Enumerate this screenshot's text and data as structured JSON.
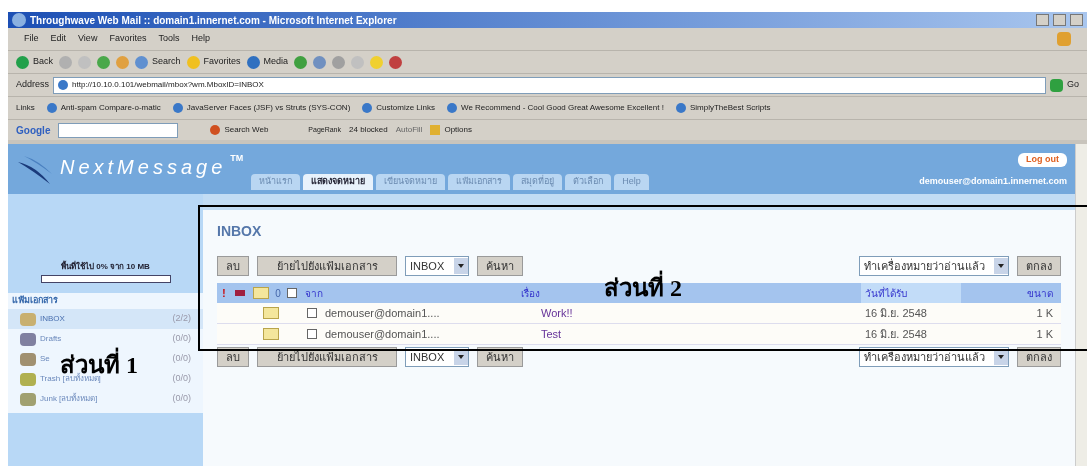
{
  "window": {
    "title": "Throughwave Web Mail :: domain1.innernet.com - Microsoft Internet Explorer"
  },
  "menu": [
    "File",
    "Edit",
    "View",
    "Favorites",
    "Tools",
    "Help"
  ],
  "toolbar": [
    {
      "kind": "back",
      "label": "Back"
    },
    {
      "kind": "forward"
    },
    {
      "kind": "stop"
    },
    {
      "kind": "refresh"
    },
    {
      "kind": "home"
    },
    {
      "kind": "search",
      "label": "Search"
    },
    {
      "kind": "favorites",
      "label": "Favorites"
    },
    {
      "kind": "media",
      "label": "Media"
    },
    {
      "kind": "history"
    },
    {
      "kind": "mail"
    },
    {
      "kind": "print"
    },
    {
      "kind": "edit"
    },
    {
      "kind": "messenger"
    },
    {
      "kind": "research"
    }
  ],
  "address": {
    "label": "Address",
    "value": "http://10.10.0.101/webmail/mbox?wm.MboxID=INBOX",
    "go": "Go"
  },
  "links": {
    "label": "Links",
    "items": [
      "Anti-spam Compare-o-matic",
      "JavaServer Faces (JSF) vs Struts (SYS-CON)",
      "Customize Links",
      "We Recommend - Cool Good Great Awesome Excellent !",
      "SimplyTheBest Scripts"
    ]
  },
  "google_bar": {
    "logo": "Google",
    "search_web": "Search Web",
    "pagerank": "PageRank",
    "blocked": "24 blocked",
    "autofill": "AutoFill",
    "options": "Options"
  },
  "header": {
    "logo": "NextMessage",
    "trademark": "TM",
    "logout": "Log out",
    "user": "demouser@domain1.innernet.com",
    "tabs": [
      {
        "label": "หน้าแรก",
        "selected": false
      },
      {
        "label": "แสดงจดหมาย",
        "selected": true
      },
      {
        "label": "เขียนจดหมาย",
        "selected": false
      },
      {
        "label": "แฟ้มเอกสาร",
        "selected": false
      },
      {
        "label": "สมุดที่อยู่",
        "selected": false
      },
      {
        "label": "ตัวเลือก",
        "selected": false
      },
      {
        "label": "Help",
        "selected": false
      }
    ]
  },
  "sidebar": {
    "quota": "พื้นที่ใช้ไป 0% จาก 10 MB",
    "quota_level": {
      "level": 0
    },
    "heading": "แฟ้มเอกสาร",
    "folders": [
      {
        "kind": "inbox",
        "name": "INBOX",
        "count": "(2/2)",
        "selected": true
      },
      {
        "kind": "drafts",
        "name": "Drafts",
        "count": "(0/0)",
        "selected": false
      },
      {
        "kind": "sent",
        "name": "Se",
        "count": "(0/0)",
        "selected": false
      },
      {
        "kind": "trash",
        "name": "Trash [ลบทั้งหมด]",
        "count": "(0/0)",
        "selected": false
      },
      {
        "kind": "junk",
        "name": "Junk [ลบทั้งหมด]",
        "count": "(0/0)",
        "selected": false
      }
    ]
  },
  "mailbox": {
    "title": "INBOX",
    "toolbars": [
      {
        "delete": "ลบ",
        "move": "ย้ายไปยังแฟ้มเอกสาร",
        "folder_select": "INBOX",
        "search": "ค้นหา",
        "mark_select": "ทำเครื่องหมายว่าอ่านแล้ว",
        "ok": "ตกลง"
      },
      {
        "delete": "ลบ",
        "move": "ย้ายไปยังแฟ้มเอกสาร",
        "folder_select": "INBOX",
        "search": "ค้นหา",
        "mark_select": "ทำเครื่องหมายว่าอ่านแล้ว",
        "ok": "ตกลง"
      }
    ],
    "columns": [
      {
        "kind": "priority",
        "label": "!"
      },
      {
        "kind": "flag"
      },
      {
        "kind": "status"
      },
      {
        "kind": "attach",
        "label": "0"
      },
      {
        "kind": "check",
        "checked": false
      },
      {
        "kind": "from",
        "label": "จาก"
      },
      {
        "kind": "subject",
        "label": "เรื่อง"
      },
      {
        "kind": "date",
        "label": "วันที่ได้รับ"
      },
      {
        "kind": "size",
        "label": "ขนาด"
      }
    ],
    "rows": [
      {
        "from": "demouser@domain1....",
        "subject": "Work!!",
        "date": "16 มิ.ย. 2548",
        "size": "1 K",
        "checked": false
      },
      {
        "from": "demouser@domain1....",
        "subject": "Test",
        "date": "16 มิ.ย. 2548",
        "size": "1 K",
        "checked": false
      }
    ]
  },
  "annotations": [
    {
      "kind": "part1",
      "label": "ส่วนที่ 1"
    },
    {
      "kind": "part2",
      "label": "ส่วนที่ 2"
    }
  ]
}
